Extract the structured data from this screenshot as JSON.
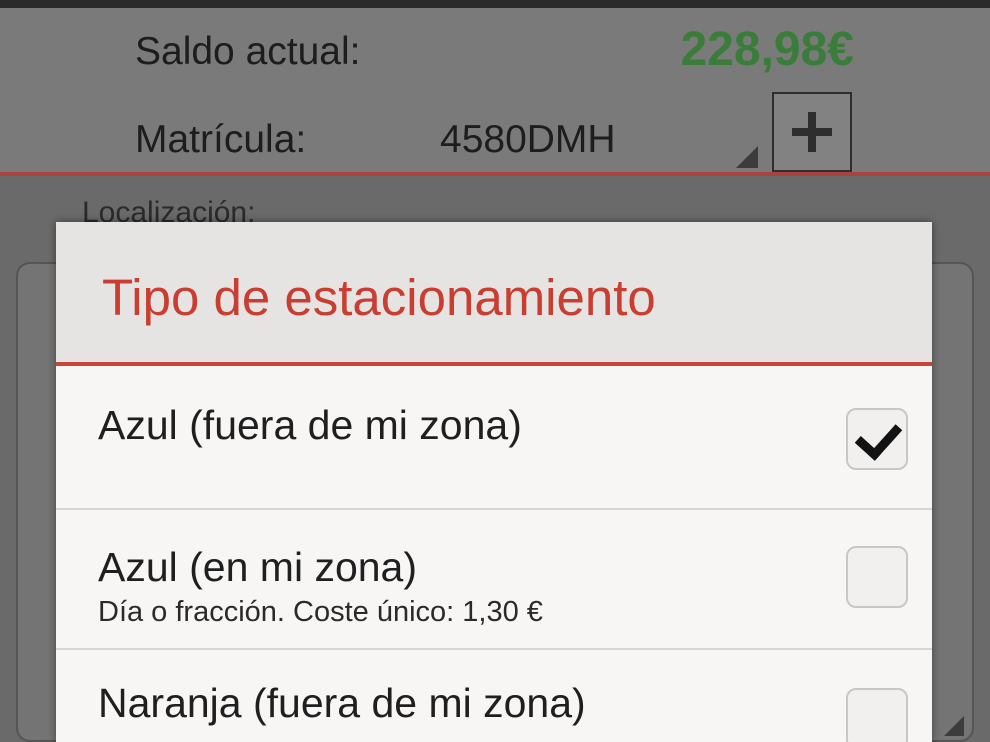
{
  "header": {
    "saldo_label": "Saldo actual:",
    "saldo_value": "228,98€",
    "matricula_label": "Matrícula:",
    "matricula_value": "4580DMH"
  },
  "background": {
    "location_label": "Localización:"
  },
  "dialog": {
    "title": "Tipo de estacionamiento",
    "options": [
      {
        "label": "Azul (fuera de mi zona)",
        "checked": true
      },
      {
        "label": "Azul (en mi zona)",
        "sub": "Día o fracción. Coste único: 1,30 €",
        "checked": false
      },
      {
        "label": "Naranja (fuera de mi zona)",
        "checked": false
      }
    ]
  },
  "colors": {
    "accent": "#c93e30",
    "balance": "#3a7d3a"
  },
  "icons": {
    "add": "plus-icon",
    "dropdown": "dropdown-corner-icon",
    "check": "checkmark-icon"
  }
}
